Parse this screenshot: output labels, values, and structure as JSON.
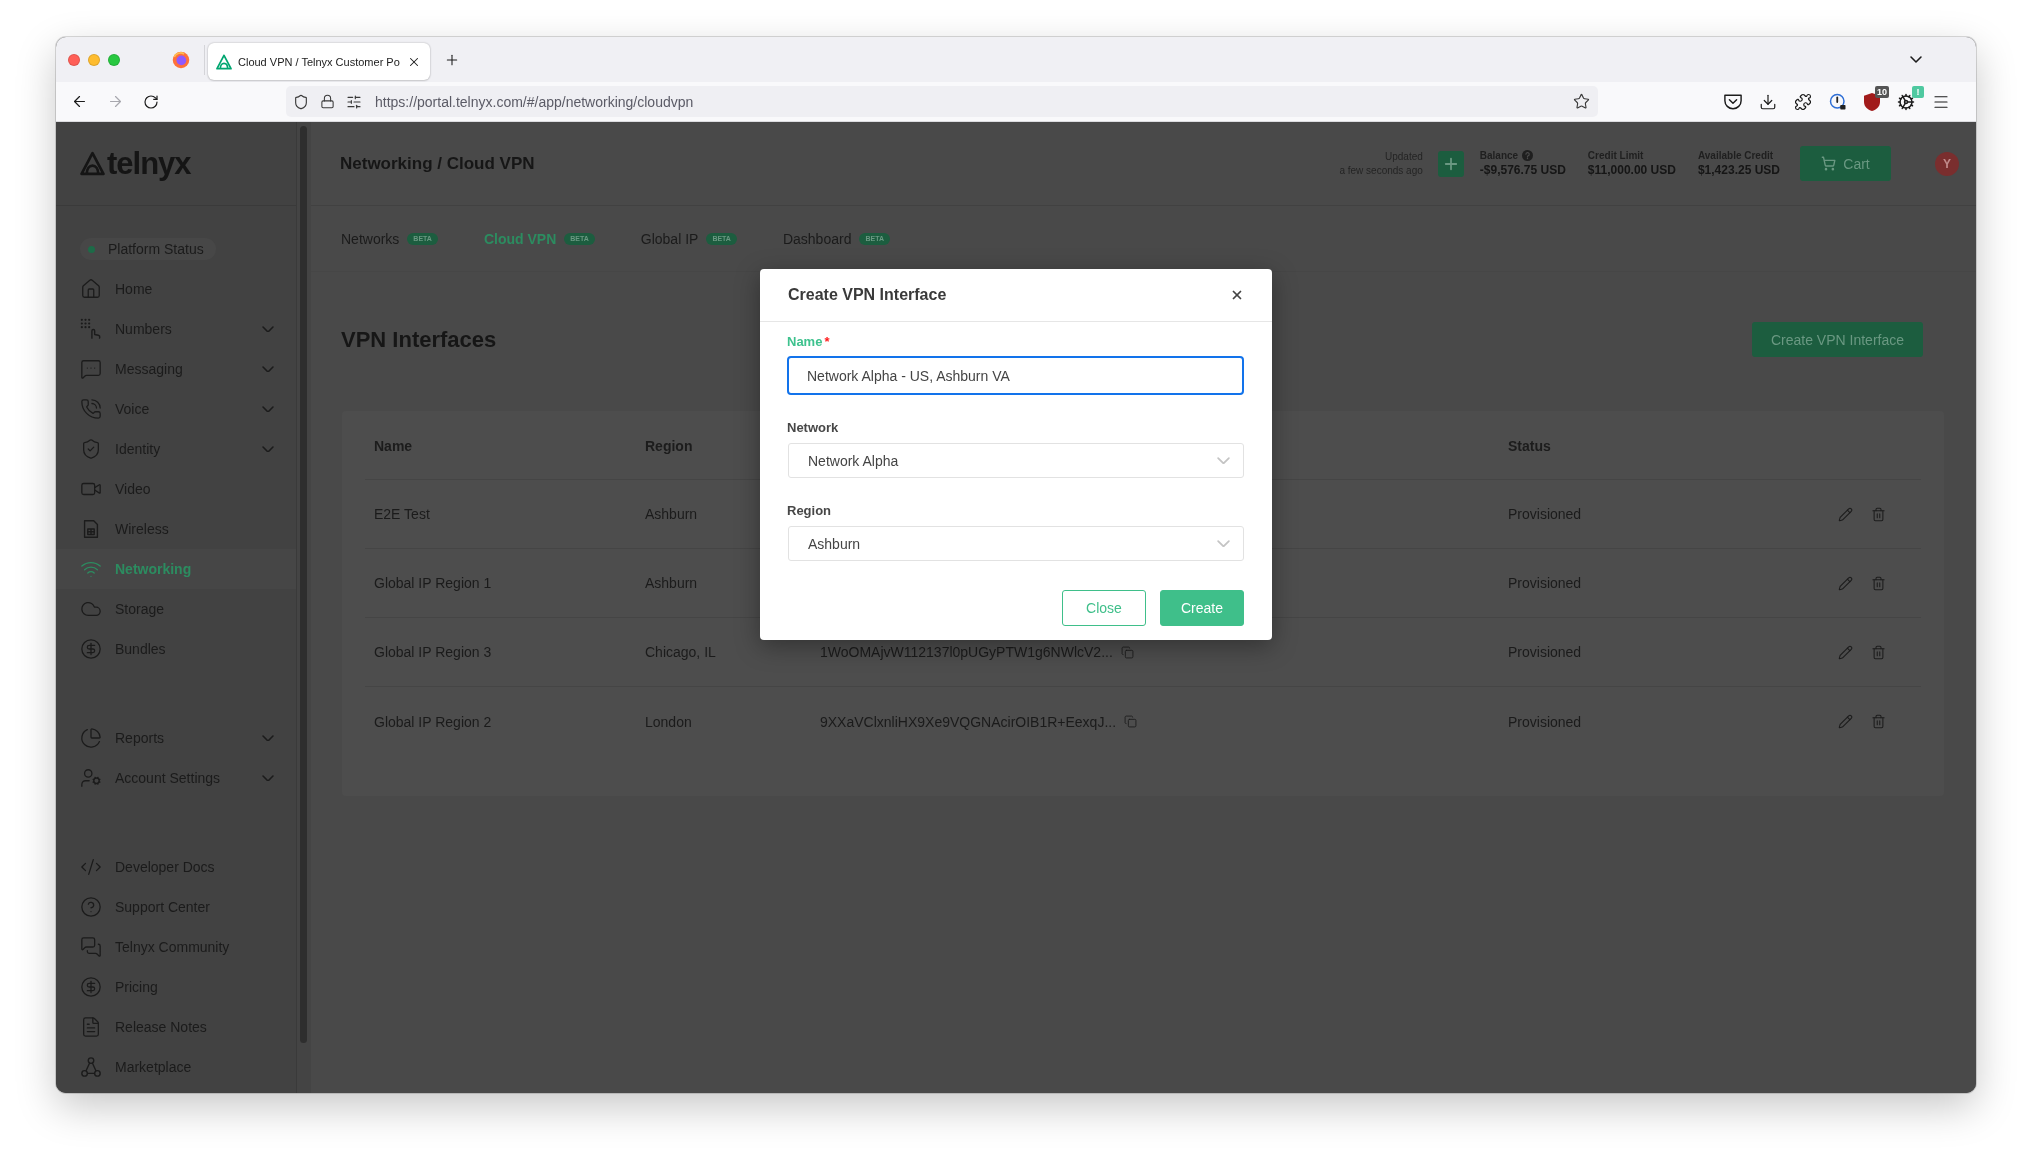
{
  "browser": {
    "tab": {
      "title": "Cloud VPN / Telnyx Customer Po",
      "selected": true
    },
    "url": "https://portal.telnyx.com/#/app/networking/cloudvpn",
    "extension_badges": [
      {
        "text": "10",
        "color": "#555555"
      },
      {
        "text": "!",
        "color": "#4fc9a0"
      }
    ]
  },
  "sidebar": {
    "logo": "telnyx",
    "platform_status": {
      "label": "Platform Status",
      "color": "#1d6b48"
    },
    "groups": [
      {
        "items": [
          {
            "label": "Home",
            "selected": false
          },
          {
            "label": "Numbers",
            "selected": false,
            "expanded": false
          },
          {
            "label": "Messaging",
            "selected": false,
            "expanded": false
          },
          {
            "label": "Voice",
            "selected": false,
            "expanded": false
          },
          {
            "label": "Identity",
            "selected": false,
            "expanded": false
          },
          {
            "label": "Video",
            "selected": false
          },
          {
            "label": "Wireless",
            "selected": false
          },
          {
            "label": "Networking",
            "selected": true
          },
          {
            "label": "Storage",
            "selected": false
          },
          {
            "label": "Bundles",
            "selected": false
          }
        ]
      },
      {
        "items": [
          {
            "label": "Reports",
            "selected": false,
            "expanded": false
          },
          {
            "label": "Account Settings",
            "selected": false,
            "expanded": false
          }
        ]
      },
      {
        "items": [
          {
            "label": "Developer Docs",
            "selected": false
          },
          {
            "label": "Support Center",
            "selected": false
          },
          {
            "label": "Telnyx Community",
            "selected": false
          },
          {
            "label": "Pricing",
            "selected": false
          },
          {
            "label": "Release Notes",
            "selected": false
          },
          {
            "label": "Marketplace",
            "selected": false
          }
        ]
      }
    ]
  },
  "header": {
    "breadcrumb": "Networking / Cloud VPN",
    "updated": {
      "label": "Updated",
      "time": "a few seconds ago"
    },
    "account": [
      {
        "label": "Balance",
        "value": "-$9,576.75 USD",
        "info": true
      },
      {
        "label": "Credit Limit",
        "value": "$11,000.00 USD",
        "info": false
      },
      {
        "label": "Available Credit",
        "value": "$1,423.25 USD",
        "info": false
      }
    ],
    "cart": "Cart",
    "avatar": "Y"
  },
  "tabs": [
    {
      "label": "Networks",
      "badge": "BETA",
      "selected": false
    },
    {
      "label": "Cloud VPN",
      "badge": "BETA",
      "selected": true
    },
    {
      "label": "Global IP",
      "badge": "BETA",
      "selected": false
    },
    {
      "label": "Dashboard",
      "badge": "BETA",
      "selected": false
    }
  ],
  "content": {
    "title": "VPN Interfaces",
    "create_button": "Create VPN Interface"
  },
  "table": {
    "columns": [
      "Name",
      "Region",
      "Status"
    ],
    "rows": [
      {
        "name": "E2E Test",
        "region": "Ashburn",
        "status": "Provisioned"
      },
      {
        "name": "Global IP Region 1",
        "region": "Ashburn",
        "status": "Provisioned"
      },
      {
        "name": "Global IP Region 3",
        "region": "Chicago, IL",
        "column_3": "1WoOMAjvW112137l0pUGyPTW1g6NWlcV2...",
        "status": "Provisioned"
      },
      {
        "name": "Global IP Region 2",
        "region": "London",
        "column_3": "9XXaVClxnliHX9Xe9VQGNAcirOIB1R+EexqJ...",
        "status": "Provisioned"
      }
    ]
  },
  "modal": {
    "title": "Create VPN Interface",
    "fields": [
      {
        "kind": "input",
        "label": "Name",
        "required_mark": "*",
        "value": "Network Alpha - US, Ashburn VA",
        "focused": true
      },
      {
        "kind": "select",
        "label": "Network",
        "value": "Network Alpha",
        "focused": false
      },
      {
        "kind": "select",
        "label": "Region",
        "value": "Ashburn",
        "focused": false
      }
    ],
    "buttons": [
      {
        "kind": "secondary",
        "label": "Close"
      },
      {
        "kind": "primary",
        "label": "Create"
      }
    ]
  }
}
